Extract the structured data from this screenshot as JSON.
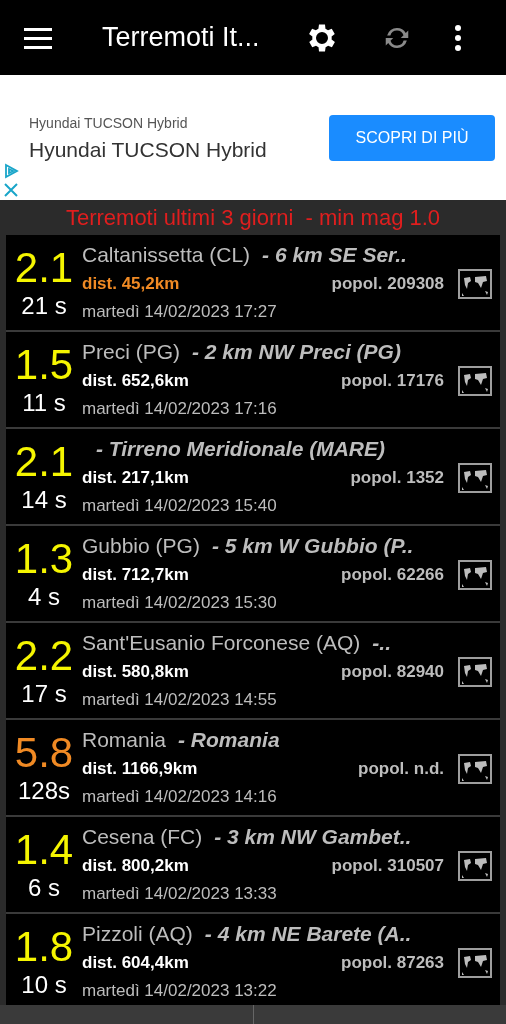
{
  "app_bar": {
    "title": "Terremoti It..."
  },
  "ad": {
    "small_title": "Hyundai TUCSON Hybrid",
    "title": "Hyundai TUCSON Hybrid",
    "button": "SCOPRI DI PIÙ"
  },
  "filter_banner": "Terremoti ultimi 3 giorni  - min mag 1.0",
  "quakes": [
    {
      "magnitude": "2.1",
      "color": "#f5f500",
      "duration": "21 s",
      "place": "Caltanissetta (CL)",
      "detail": "- 6 km SE Ser..",
      "distance": "dist. 45,2km",
      "near": true,
      "population": "popol. 209308",
      "date": "martedì 14/02/2023 17:27"
    },
    {
      "magnitude": "1.5",
      "color": "#f5f500",
      "duration": "11 s",
      "place": "Preci (PG)",
      "detail": "- 2 km NW Preci (PG)",
      "distance": "dist. 652,6km",
      "near": false,
      "population": "popol. 17176",
      "date": "martedì 14/02/2023 17:16"
    },
    {
      "magnitude": "2.1",
      "color": "#f5f500",
      "duration": "14 s",
      "detail": "- Tirreno Meridionale (MARE)",
      "distance": "dist. 217,1km",
      "near": false,
      "population": "popol. 1352",
      "date": "martedì 14/02/2023 15:40"
    },
    {
      "magnitude": "1.3",
      "color": "#f5f500",
      "duration": "4 s",
      "place": "Gubbio (PG)",
      "detail": "- 5 km W Gubbio (P..",
      "distance": "dist. 712,7km",
      "near": false,
      "population": "popol. 62266",
      "date": "martedì 14/02/2023 15:30"
    },
    {
      "magnitude": "2.2",
      "color": "#f5f500",
      "duration": "17 s",
      "place": "Sant'Eusanio Forconese (AQ)",
      "detail": "-..",
      "distance": "dist. 580,8km",
      "near": false,
      "population": "popol. 82940",
      "date": "martedì 14/02/2023 14:55"
    },
    {
      "magnitude": "5.8",
      "color": "#f08a24",
      "duration": "128s",
      "place": "Romania",
      "detail": "- Romania",
      "distance": "dist. 1166,9km",
      "near": false,
      "population": "popol. n.d.",
      "date": "martedì 14/02/2023 14:16"
    },
    {
      "magnitude": "1.4",
      "color": "#f5f500",
      "duration": "6 s",
      "place": "Cesena (FC)",
      "detail": "- 3 km NW Gambet..",
      "distance": "dist. 800,2km",
      "near": false,
      "population": "popol. 310507",
      "date": "martedì 14/02/2023 13:33"
    },
    {
      "magnitude": "1.8",
      "color": "#f5f500",
      "duration": "10 s",
      "place": "Pizzoli (AQ)",
      "detail": "- 4 km NE Barete (A..",
      "distance": "dist. 604,4km",
      "near": false,
      "population": "popol. 87263",
      "date": "martedì 14/02/2023 13:22"
    }
  ]
}
